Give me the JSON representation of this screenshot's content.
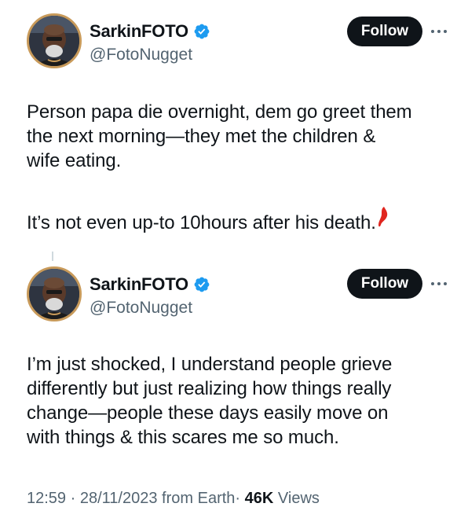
{
  "tweets": [
    {
      "author": {
        "display_name": "SarkinFOTO",
        "handle": "@FotoNugget",
        "verified": true,
        "avatar_icon": "avatar-photo-icon"
      },
      "follow_label": "Follow",
      "paragraphs": [
        "Person papa die overnight, dem go greet them\nthe next morning—they met the children &\nwife eating.",
        "It’s not even up-to 10hours after his death."
      ]
    },
    {
      "author": {
        "display_name": "SarkinFOTO",
        "handle": "@FotoNugget",
        "verified": true,
        "avatar_icon": "avatar-photo-icon"
      },
      "follow_label": "Follow",
      "paragraphs": [
        "I’m just shocked, I understand people grieve\ndifferently but just realizing how things really\nchange—people these days easily move on\nwith things & this scares me so much."
      ],
      "meta": {
        "time": "12:59",
        "separator": "·",
        "date": "28/11/2023",
        "source": "from Earth",
        "views_count": "46K",
        "views_label": "Views"
      }
    }
  ],
  "colors": {
    "text_primary": "#0f1419",
    "text_secondary": "#536471",
    "verified_blue": "#1d9bf0",
    "follow_bg": "#0f1419",
    "annotation_red": "#e0261f"
  }
}
